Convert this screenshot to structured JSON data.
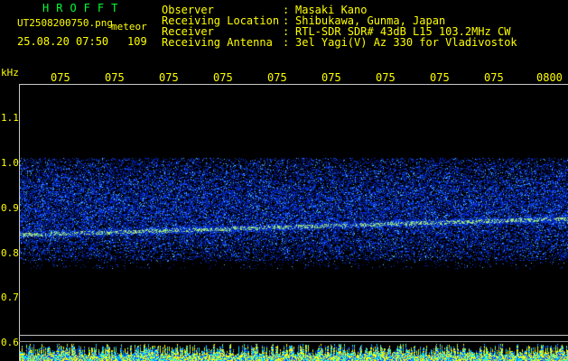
{
  "header": {
    "brand": "HROFFT",
    "filename": "UT2508200750.png",
    "mode": "meteor",
    "datetime": "25.08.20 07:50",
    "count": "109"
  },
  "station": {
    "rows": [
      {
        "label": "Observer",
        "value": "Masaki Kano"
      },
      {
        "label": "Receiving Location",
        "value": "Shibukawa, Gunma, Japan"
      },
      {
        "label": "Receiver",
        "value": "RTL-SDR SDR# 43dB L15 103.2MHz CW"
      },
      {
        "label": "Receiving Antenna",
        "value": "3el Yagi(V) Az 330 for Vladivostok"
      }
    ],
    "separator": ":"
  },
  "axes": {
    "y_unit": "kHz",
    "y_ticks": [
      "1.1",
      "1.0",
      "0.9",
      "0.8",
      "0.7",
      "0.6"
    ],
    "x_ticks": [
      "075",
      "075",
      "075",
      "075",
      "075",
      "075",
      "075",
      "075",
      "075",
      "0800"
    ]
  },
  "colors": {
    "text": "#ffff00",
    "brand": "#00ff33",
    "background": "#000000",
    "frame": "#c8c8c8"
  }
}
